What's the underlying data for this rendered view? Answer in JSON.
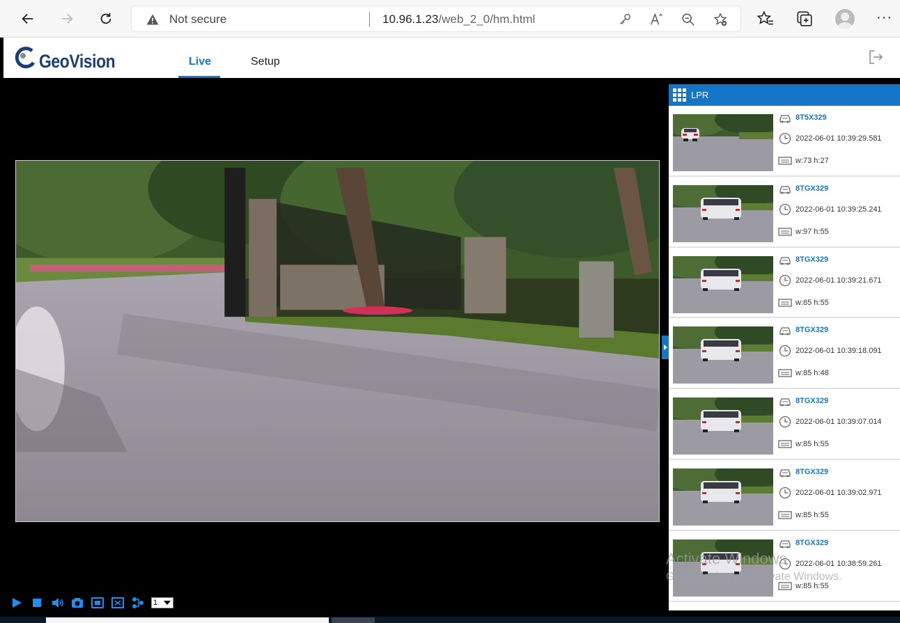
{
  "browser": {
    "security_label": "Not secure",
    "url_host": "10.96.1.23",
    "url_path": "/web_2_0/hm.html",
    "more_label": "···"
  },
  "app": {
    "logo_text": "GeoVision",
    "tabs": [
      {
        "label": "Live",
        "active": true
      },
      {
        "label": "Setup",
        "active": false
      }
    ],
    "accent_color": "#1576c8"
  },
  "controls": {
    "icons": [
      "play-icon",
      "stop-icon",
      "volume-icon",
      "snapshot-icon",
      "record-icon",
      "fullscreen-icon",
      "stream-icon"
    ],
    "stream_value": "1"
  },
  "lpr": {
    "title": "LPR",
    "items": [
      {
        "plate": "8T5X329",
        "time": "2022-06-01 10:39:29.581",
        "size": "w:73 h:27"
      },
      {
        "plate": "8TGX329",
        "time": "2022-06-01 10:39:25.241",
        "size": "w:97 h:55"
      },
      {
        "plate": "8TGX329",
        "time": "2022-06-01 10:39:21.671",
        "size": "w:85 h:55"
      },
      {
        "plate": "8TGX329",
        "time": "2022-06-01 10:39:18.091",
        "size": "w:85 h:48"
      },
      {
        "plate": "8TGX329",
        "time": "2022-06-01 10:39:07.014",
        "size": "w:85 h:55"
      },
      {
        "plate": "8TGX329",
        "time": "2022-06-01 10:39:02.971",
        "size": "w:85 h:55"
      },
      {
        "plate": "8TGX329",
        "time": "2022-06-01 10:38:59.261",
        "size": "w:85 h:55"
      }
    ]
  },
  "watermark": {
    "line1": "Activate Windows",
    "line2": "Go to Settings to activate Windows."
  }
}
